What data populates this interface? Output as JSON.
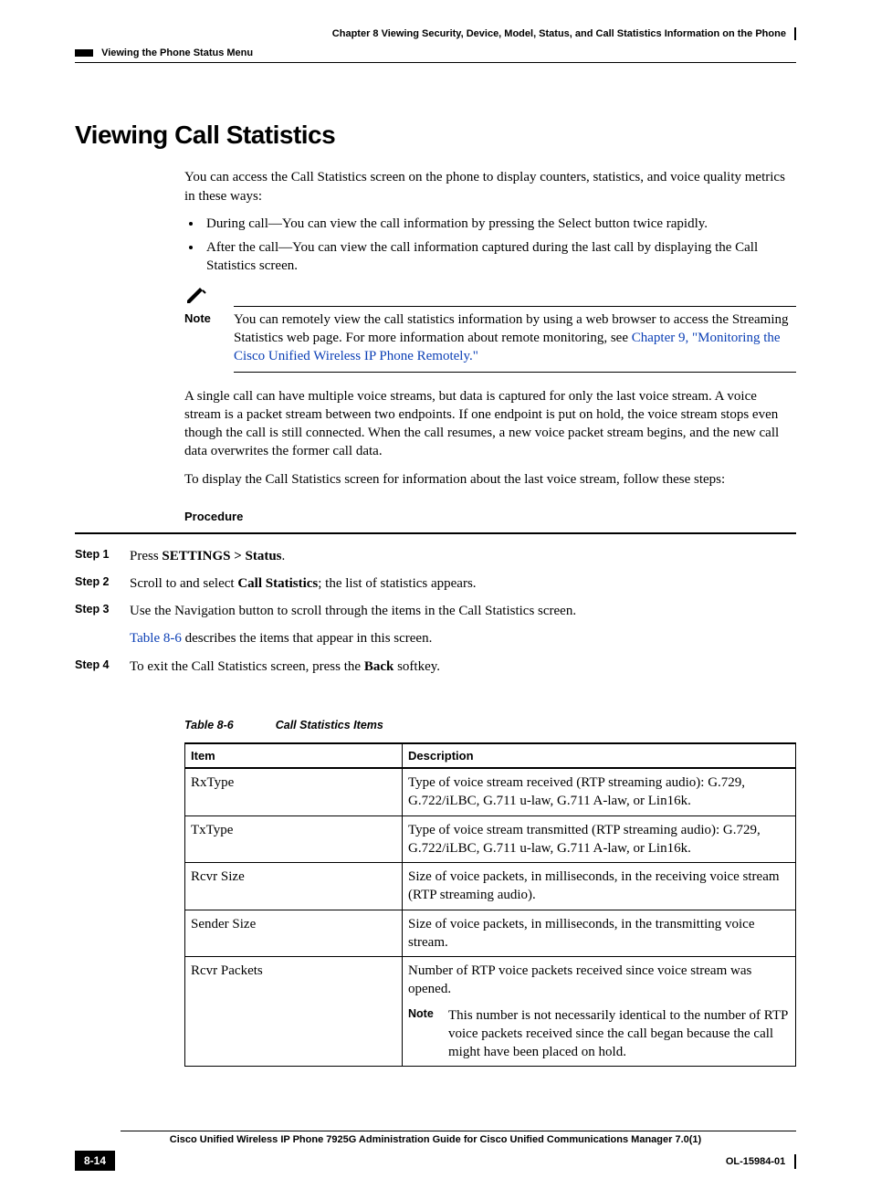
{
  "header": {
    "chapter": "Chapter 8    Viewing Security, Device, Model, Status, and Call Statistics Information on the Phone",
    "section": "Viewing the Phone Status Menu"
  },
  "title": "Viewing Call Statistics",
  "intro": "You can access the Call Statistics screen on the phone to display counters, statistics, and voice quality metrics in these ways:",
  "bullets": [
    "During call—You can view the call information by pressing the Select button twice rapidly.",
    "After the call—You can view the call information captured during the last call by displaying the Call Statistics screen."
  ],
  "note": {
    "label": "Note",
    "text_a": "You can remotely view the call statistics information by using a web browser to access the Streaming Statistics web page. For more information about remote monitoring, see ",
    "link": "Chapter 9, \"Monitoring the Cisco Unified Wireless IP Phone Remotely.\""
  },
  "para2": "A single call can have multiple voice streams, but data is captured for only the last voice stream. A voice stream is a packet stream between two endpoints. If one endpoint is put on hold, the voice stream stops even though the call is still connected. When the call resumes, a new voice packet stream begins, and the new call data overwrites the former call data.",
  "para3": "To display the Call Statistics screen for information about the last voice stream, follow these steps:",
  "procedure_label": "Procedure",
  "steps": {
    "s1": {
      "label": "Step 1",
      "pre": "Press ",
      "bold": "SETTINGS > Status",
      "post": "."
    },
    "s2": {
      "label": "Step 2",
      "pre": "Scroll to and select ",
      "bold": "Call Statistics",
      "post": "; the list of statistics appears."
    },
    "s3": {
      "label": "Step 3",
      "text": "Use the Navigation button to scroll through the items in the Call Statistics screen.",
      "link": "Table 8-6",
      "tail": " describes the items that appear in this screen."
    },
    "s4": {
      "label": "Step 4",
      "pre": "To exit the Call Statistics screen, press the ",
      "bold": "Back",
      "post": " softkey."
    }
  },
  "table": {
    "caption_num": "Table 8-6",
    "caption_title": "Call Statistics Items",
    "headers": {
      "c1": "Item",
      "c2": "Description"
    },
    "rows": [
      {
        "item": "RxType",
        "desc": "Type of voice stream received (RTP streaming audio): G.729, G.722/iLBC, G.711 u-law, G.711 A-law, or Lin16k."
      },
      {
        "item": "TxType",
        "desc": "Type of voice stream transmitted (RTP streaming audio): G.729, G.722/iLBC, G.711 u-law, G.711 A-law, or Lin16k."
      },
      {
        "item": "Rcvr Size",
        "desc": "Size of voice packets, in milliseconds, in the receiving voice stream (RTP streaming audio)."
      },
      {
        "item": "Sender Size",
        "desc": "Size of voice packets, in milliseconds, in the transmitting voice stream."
      },
      {
        "item": "Rcvr Packets",
        "desc": "Number of RTP voice packets received since voice stream was opened.",
        "note_label": "Note",
        "note": "This number is not necessarily identical to the number of RTP voice packets received since the call began because the call might have been placed on hold."
      }
    ]
  },
  "footer": {
    "title": "Cisco Unified Wireless IP Phone 7925G Administration Guide for Cisco Unified Communications Manager 7.0(1)",
    "page": "8-14",
    "docid": "OL-15984-01"
  }
}
